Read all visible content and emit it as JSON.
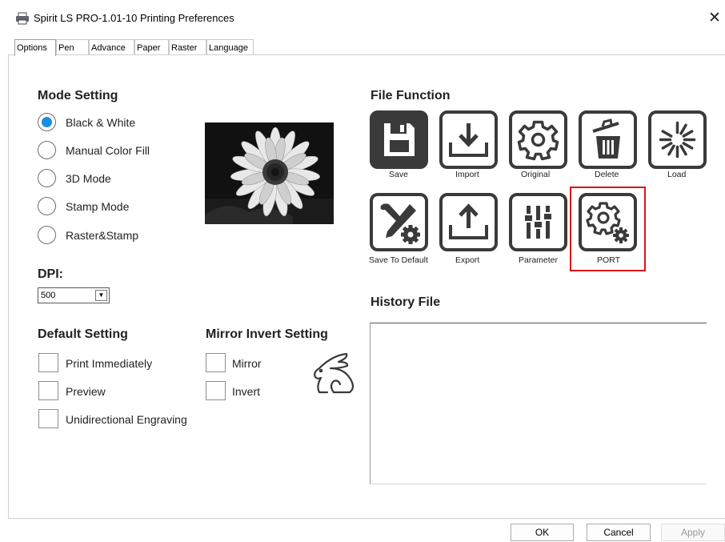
{
  "window": {
    "title": "Spirit LS PRO-1.01-10 Printing Preferences",
    "close_glyph": "✕",
    "icon": "printer-icon"
  },
  "tabs": [
    {
      "label": "Options",
      "active": true
    },
    {
      "label": "Pen",
      "active": false
    },
    {
      "label": "Advance",
      "active": false
    },
    {
      "label": "Paper",
      "active": false
    },
    {
      "label": "Raster",
      "active": false
    },
    {
      "label": "Language",
      "active": false
    }
  ],
  "mode_setting": {
    "title": "Mode Setting",
    "selected": "Black & White",
    "options": [
      "Black & White",
      "Manual Color Fill",
      "3D Mode",
      "Stamp Mode",
      "Raster&Stamp"
    ]
  },
  "dpi": {
    "label": "DPI:",
    "value": "500"
  },
  "default_setting": {
    "title": "Default Setting",
    "options": [
      {
        "label": "Print Immediately",
        "checked": false
      },
      {
        "label": "Preview",
        "checked": false
      },
      {
        "label": "Unidirectional Engraving",
        "checked": false
      }
    ]
  },
  "mirror_invert": {
    "title": "Mirror  Invert Setting",
    "options": [
      {
        "label": "Mirror",
        "checked": false
      },
      {
        "label": "Invert",
        "checked": false
      }
    ]
  },
  "file_function": {
    "title": "File Function",
    "buttons": [
      {
        "label": "Save",
        "icon": "floppy-save-icon"
      },
      {
        "label": "Import",
        "icon": "tray-download-icon"
      },
      {
        "label": "Original",
        "icon": "gear-icon"
      },
      {
        "label": "Delete",
        "icon": "trash-icon"
      },
      {
        "label": "Load",
        "icon": "loading-spinner-icon"
      },
      {
        "label": "Save To Default",
        "icon": "wrench-screwdriver-gear-icon"
      },
      {
        "label": "Export",
        "icon": "tray-upload-icon"
      },
      {
        "label": "Parameter",
        "icon": "sliders-icon"
      },
      {
        "label": "PORT",
        "icon": "gears-icon"
      }
    ]
  },
  "history": {
    "title": "History File"
  },
  "footer": {
    "ok": "OK",
    "cancel": "Cancel",
    "apply": "Apply"
  },
  "colors": {
    "accent": "#1a8fe0",
    "highlight": "#d8151b",
    "icon": "#3a3a3a"
  }
}
